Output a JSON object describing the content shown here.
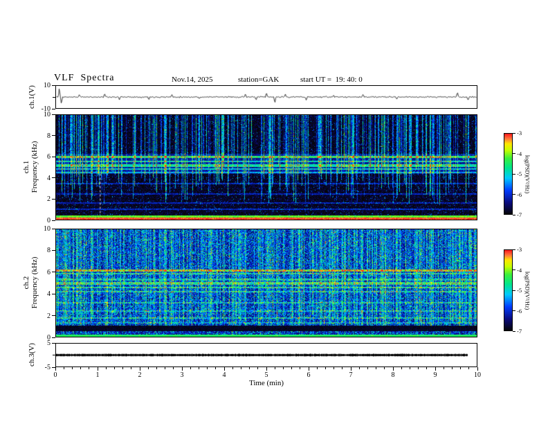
{
  "header": {
    "title": "VLF  Spectra",
    "date": "Nov.14, 2025",
    "station": "station=GAK",
    "start_ut": "start UT =  19: 40: 0"
  },
  "axes": {
    "x": {
      "label": "Time  (min)",
      "range": [
        0,
        10
      ],
      "ticks": [
        0,
        1,
        2,
        3,
        4,
        5,
        6,
        7,
        8,
        9,
        10
      ],
      "minor_step": 0.2
    },
    "ch1_wave": {
      "label": "ch.1(V)",
      "range": [
        -10,
        10
      ],
      "ticks": [
        10,
        -10
      ]
    },
    "spec1": {
      "channel": "ch.1",
      "label": "Frequency (kHz)",
      "range": [
        0,
        10
      ],
      "ticks": [
        0,
        2,
        4,
        6,
        8,
        10
      ]
    },
    "spec2": {
      "channel": "ch.2",
      "label": "Frequency (kHz)",
      "range": [
        0,
        10
      ],
      "ticks": [
        0,
        2,
        4,
        6,
        8,
        10
      ]
    },
    "ch3": {
      "label": "ch.3(V)",
      "range": [
        -5,
        5
      ],
      "ticks": [
        5,
        -5
      ]
    }
  },
  "colorbar": {
    "label": "log(PSD)(V²/Hz)",
    "range": [
      -7,
      -3
    ],
    "ticks": [
      -3,
      -4,
      -5,
      -6,
      -7
    ],
    "stops": [
      [
        0,
        [
          5,
          5,
          5
        ]
      ],
      [
        0.14,
        [
          10,
          10,
          120
        ]
      ],
      [
        0.3,
        [
          0,
          60,
          255
        ]
      ],
      [
        0.45,
        [
          0,
          200,
          255
        ]
      ],
      [
        0.58,
        [
          0,
          230,
          140
        ]
      ],
      [
        0.7,
        [
          60,
          240,
          60
        ]
      ],
      [
        0.8,
        [
          200,
          255,
          0
        ]
      ],
      [
        0.88,
        [
          255,
          230,
          0
        ]
      ],
      [
        0.94,
        [
          255,
          120,
          60
        ]
      ],
      [
        1,
        [
          255,
          30,
          30
        ]
      ]
    ]
  },
  "chart_data": [
    {
      "type": "line",
      "name": "ch.1 voltage waveform",
      "ylabel": "ch.1(V)",
      "x_range": [
        0,
        10
      ],
      "y_range": [
        -10,
        10
      ],
      "description": "Noisy broadband trace near 0 V with sporadic impulsive spikes up to about ±8 V",
      "gen": {
        "seed": 11,
        "noise_sigma": 0.55,
        "events": [
          {
            "x": 0.07,
            "a": 8.5
          },
          {
            "x": 0.12,
            "a": -6.5
          },
          {
            "x": 0.55,
            "a": 2.2
          },
          {
            "x": 1.15,
            "a": 3.0
          },
          {
            "x": 1.5,
            "a": -2.2
          },
          {
            "x": 2.2,
            "a": -2.6
          },
          {
            "x": 2.75,
            "a": 2.2
          },
          {
            "x": 3.4,
            "a": -2.0
          },
          {
            "x": 4.5,
            "a": 3.2
          },
          {
            "x": 4.75,
            "a": -3.0
          },
          {
            "x": 5.0,
            "a": 4.0
          },
          {
            "x": 5.2,
            "a": -6.0
          },
          {
            "x": 5.45,
            "a": 3.0
          },
          {
            "x": 5.95,
            "a": -2.6
          },
          {
            "x": 6.6,
            "a": 2.0
          },
          {
            "x": 7.3,
            "a": 2.6
          },
          {
            "x": 8.1,
            "a": -2.2
          },
          {
            "x": 9.55,
            "a": 5.0
          },
          {
            "x": 9.8,
            "a": -3.0
          }
        ]
      }
    },
    {
      "type": "heatmap",
      "name": "ch.1 spectrogram",
      "ylabel": "Frequency (kHz)",
      "x_range": [
        0,
        10
      ],
      "y_range": [
        0,
        10
      ],
      "value_range": [
        -7,
        -3
      ],
      "value_label": "log(PSD)(V²/Hz)",
      "description": "Dark background above 6 kHz crossed by dense vertical sferic streaks (green/yellow), horizontal cyan transmitter lines between 4.5 and 6 kHz, dark blue speckle below 4.5 kHz, intense red/yellow band below 0.4 kHz",
      "gen": {
        "seed": 42,
        "base": -6.85,
        "noise": 0.3,
        "speckle_prob": 0.05,
        "speckle_boost": 1.3,
        "regions": [
          {
            "f0": 4.4,
            "f1": 6.35,
            "boost": 0.55
          }
        ],
        "vstreaks": {
          "density": 0.42,
          "strength": 2.9,
          "floor_mean": 6.0,
          "floor_spread": 4.5
        },
        "hbands": [
          {
            "f": 6.05,
            "w": 0.1,
            "boost": 2.3
          },
          {
            "f": 5.6,
            "w": 0.09,
            "boost": 1.7
          },
          {
            "f": 5.2,
            "w": 0.12,
            "boost": 1.9
          },
          {
            "f": 4.85,
            "w": 0.08,
            "boost": 1.5
          },
          {
            "f": 4.55,
            "w": 0.08,
            "boost": 1.3
          },
          {
            "f": 3.5,
            "w": 0.06,
            "boost": 1.0
          },
          {
            "f": 2.5,
            "w": 0.06,
            "boost": 0.9
          },
          {
            "f": 1.6,
            "w": 0.06,
            "boost": 0.9
          },
          {
            "f": 1.0,
            "w": 0.06,
            "boost": 1.0
          }
        ],
        "bottom": [
          {
            "f": 0.3,
            "w": 0.12,
            "level": -4.1
          },
          {
            "f": 0.12,
            "w": 0.1,
            "level": -3.1
          }
        ],
        "markers": [
          {
            "x": 1.05,
            "f0": 0.4,
            "f1": 4.4
          }
        ]
      }
    },
    {
      "type": "heatmap",
      "name": "ch.2 spectrogram",
      "ylabel": "Frequency (kHz)",
      "x_range": [
        0,
        10
      ],
      "y_range": [
        0,
        10
      ],
      "value_range": [
        -7,
        -3
      ],
      "value_label": "log(PSD)(V²/Hz)",
      "description": "Brighter cyan/blue speckled background across all frequencies with dense vertical streaks, strong yellow-green line near 6.2 kHz, cyan lines near 4-5 kHz, dark band near 0.6-1 kHz and bright line near 0.15 kHz",
      "gen": {
        "seed": 99,
        "base": -6.25,
        "noise": 0.45,
        "speckle_prob": 0.28,
        "speckle_boost": 1.3,
        "regions": [],
        "vstreaks": {
          "density": 0.5,
          "strength": 1.9,
          "floor_mean": 2.0,
          "floor_spread": 2.0
        },
        "hbands": [
          {
            "f": 6.2,
            "w": 0.12,
            "boost": 2.6
          },
          {
            "f": 5.9,
            "w": 0.07,
            "boost": 1.3
          },
          {
            "f": 5.35,
            "w": 0.07,
            "boost": 1.1
          },
          {
            "f": 5.0,
            "w": 0.1,
            "boost": 1.6
          },
          {
            "f": 4.6,
            "w": 0.08,
            "boost": 1.4
          },
          {
            "f": 4.2,
            "w": 0.07,
            "boost": 1.2
          },
          {
            "f": 3.2,
            "w": 0.07,
            "boost": 1.0
          },
          {
            "f": 2.4,
            "w": 0.07,
            "boost": 1.0
          },
          {
            "f": 1.8,
            "w": 0.07,
            "boost": 1.1
          },
          {
            "f": 1.3,
            "w": 0.06,
            "boost": 0.9
          }
        ],
        "darkbands": [
          {
            "f0": 0.55,
            "f1": 1.05,
            "set": -6.85
          }
        ],
        "bottom": [
          {
            "f": 0.15,
            "w": 0.1,
            "level": -4.4
          }
        ],
        "markers": []
      }
    },
    {
      "type": "line",
      "name": "ch.3 voltage waveform",
      "ylabel": "ch.3(V)",
      "x_range": [
        0,
        10
      ],
      "y_range": [
        -5,
        5
      ],
      "description": "Flat dark trace at 0 V extending from 0 to about 9.78 min",
      "gen": {
        "seed": 5,
        "value": 0,
        "end_frac": 0.978,
        "thickness": 3
      }
    }
  ]
}
